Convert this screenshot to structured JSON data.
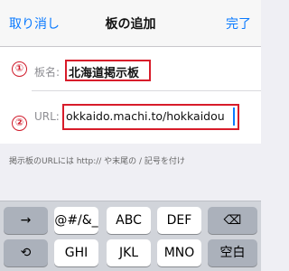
{
  "nav": {
    "left": "取り消し",
    "title": "板の追加",
    "right": "完了"
  },
  "markers": [
    "①",
    "②"
  ],
  "fields": [
    {
      "label": "板名:",
      "value": "北海道掲示板"
    },
    {
      "label": "URL:",
      "value": "okkaido.machi.to/hokkaidou"
    }
  ],
  "hint": "掲示板のURLには http:// や末尾の / 記号を付け",
  "keyboard": {
    "rows": [
      [
        {
          "label": "→",
          "icon": "arrow-right-icon"
        },
        {
          "label": "@#/&_"
        },
        {
          "label": "ABC"
        },
        {
          "label": "DEF"
        },
        {
          "label": "⌫",
          "icon": "backspace-icon"
        }
      ],
      [
        {
          "label": "⟲",
          "icon": "undo-icon"
        },
        {
          "label": "GHI"
        },
        {
          "label": "JKL"
        },
        {
          "label": "MNO"
        },
        {
          "label": "空白"
        }
      ]
    ]
  },
  "colors": {
    "accent": "#0a7aff",
    "highlight": "#d81c2a"
  }
}
